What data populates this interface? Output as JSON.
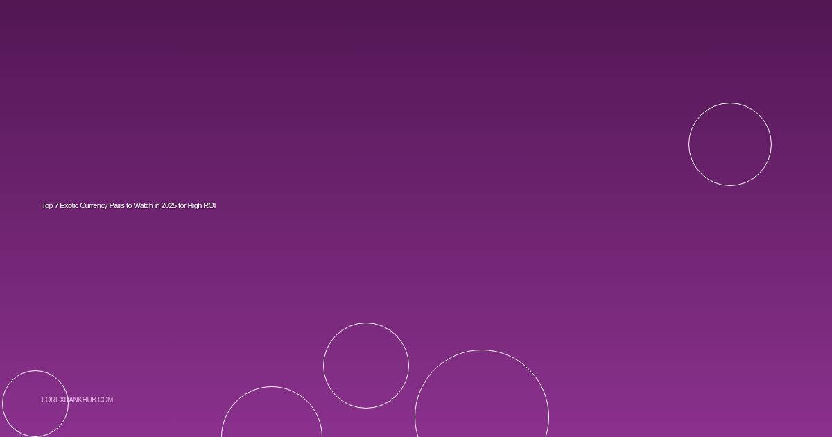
{
  "title": "Top 7 Exotic Currency Pairs to Watch in 2025 for High ROI",
  "site": "FOREXRANKHUB.COM"
}
